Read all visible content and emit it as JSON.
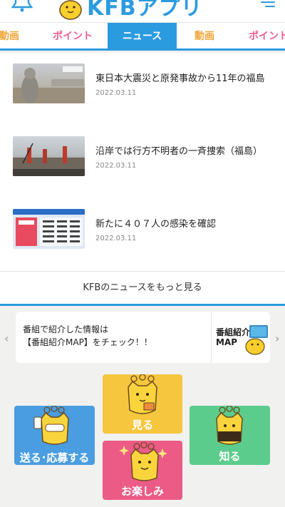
{
  "header": {
    "logo_text": "KFBアプリ"
  },
  "tabs": [
    {
      "label": "動画"
    },
    {
      "label": "ポイント"
    },
    {
      "label": "ニュース"
    },
    {
      "label": "動画"
    },
    {
      "label": "ポイント"
    }
  ],
  "news": {
    "items": [
      {
        "title": "東日本大震災と原発事故から11年の福島",
        "date": "2022.03.11"
      },
      {
        "title": "沿岸では行方不明者の一斉捜索（福島）",
        "date": "2022.03.11"
      },
      {
        "title": "新たに４０７人の感染を確認",
        "date": "2022.03.11"
      }
    ],
    "more_label": "KFBのニュースをもっと見る"
  },
  "banner": {
    "line1": "番組で紹介した情報は",
    "line2": "【番組紹介MAP】をチェック！！",
    "map_line1": "番組紹介",
    "map_line2": "MAP",
    "prev_arrow": "‹",
    "next_arrow": "›"
  },
  "tiles": {
    "miru": "見る",
    "okuru": "送る･応募する",
    "shiru": "知る",
    "otanoshimi": "お楽しみ"
  },
  "colors": {
    "accent_blue": "#2b9be0",
    "pink": "#ef5f8e",
    "yellow": "#f0a83c",
    "tile_yellow": "#f6c63e",
    "tile_blue": "#4a9de0",
    "tile_green": "#5ccc8c",
    "tile_pink": "#ec5a86"
  }
}
